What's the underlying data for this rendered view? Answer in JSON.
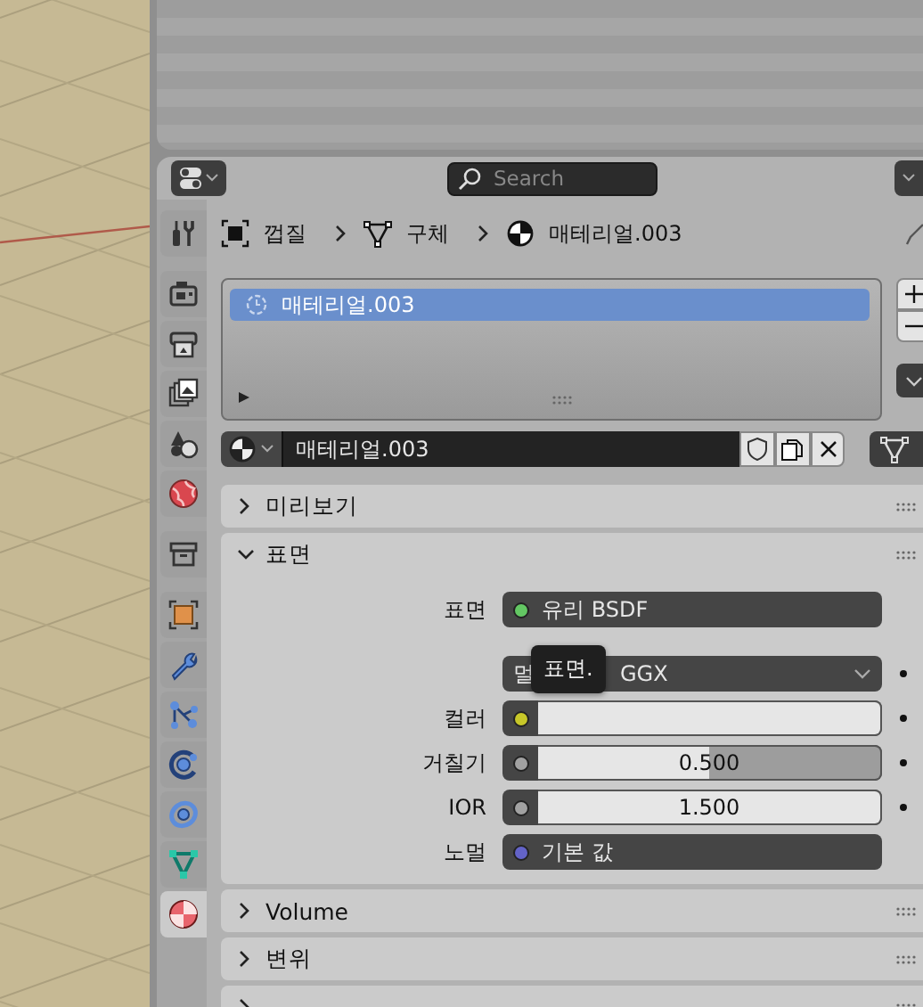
{
  "search": {
    "placeholder": "Search"
  },
  "property_tabs": [
    {
      "selected": false
    },
    {
      "selected": false
    },
    {
      "selected": false
    },
    {
      "selected": false
    },
    {
      "selected": false
    },
    {
      "selected": false
    },
    {
      "selected": false
    },
    {
      "selected": false
    },
    {
      "selected": false
    },
    {
      "selected": false
    },
    {
      "selected": false
    },
    {
      "selected": false
    },
    {
      "selected": false
    },
    {
      "selected": true
    }
  ],
  "breadcrumb": [
    {
      "text": "껍질"
    },
    {
      "text": "구체"
    },
    {
      "text": "매테리얼.003"
    }
  ],
  "material_slots": [
    {
      "name": "매테리얼.003",
      "selected": true
    }
  ],
  "material": {
    "name": "매테리얼.003"
  },
  "panels": [
    {
      "title": "미리보기",
      "expanded": false
    },
    {
      "title": "표면",
      "expanded": true,
      "rows": [
        {
          "kind": "shader",
          "label": "표면",
          "value": "유리 BSDF",
          "color": "#63c763",
          "animatable": false
        },
        {
          "kind": "dropdown",
          "value_start": "멀",
          "value_end": "GGX",
          "animatable": true
        },
        {
          "kind": "swatch",
          "label": "컬러",
          "color": "#c7c729",
          "animatable": true
        },
        {
          "kind": "slider",
          "label": "거칠기",
          "color": "#a1a1a1",
          "value": "0.500",
          "level": 0.5,
          "animatable": true
        },
        {
          "kind": "number",
          "label": "IOR",
          "color": "#a1a1a1",
          "value": "1.500",
          "animatable": true
        },
        {
          "kind": "shader",
          "label": "노멀",
          "value": "기본 값",
          "color": "#6363c7",
          "animatable": false
        }
      ]
    },
    {
      "title": "Volume",
      "expanded": false
    },
    {
      "title": "변위",
      "expanded": false
    },
    {
      "expanded": false
    }
  ],
  "tooltip": {
    "text": "표면."
  }
}
